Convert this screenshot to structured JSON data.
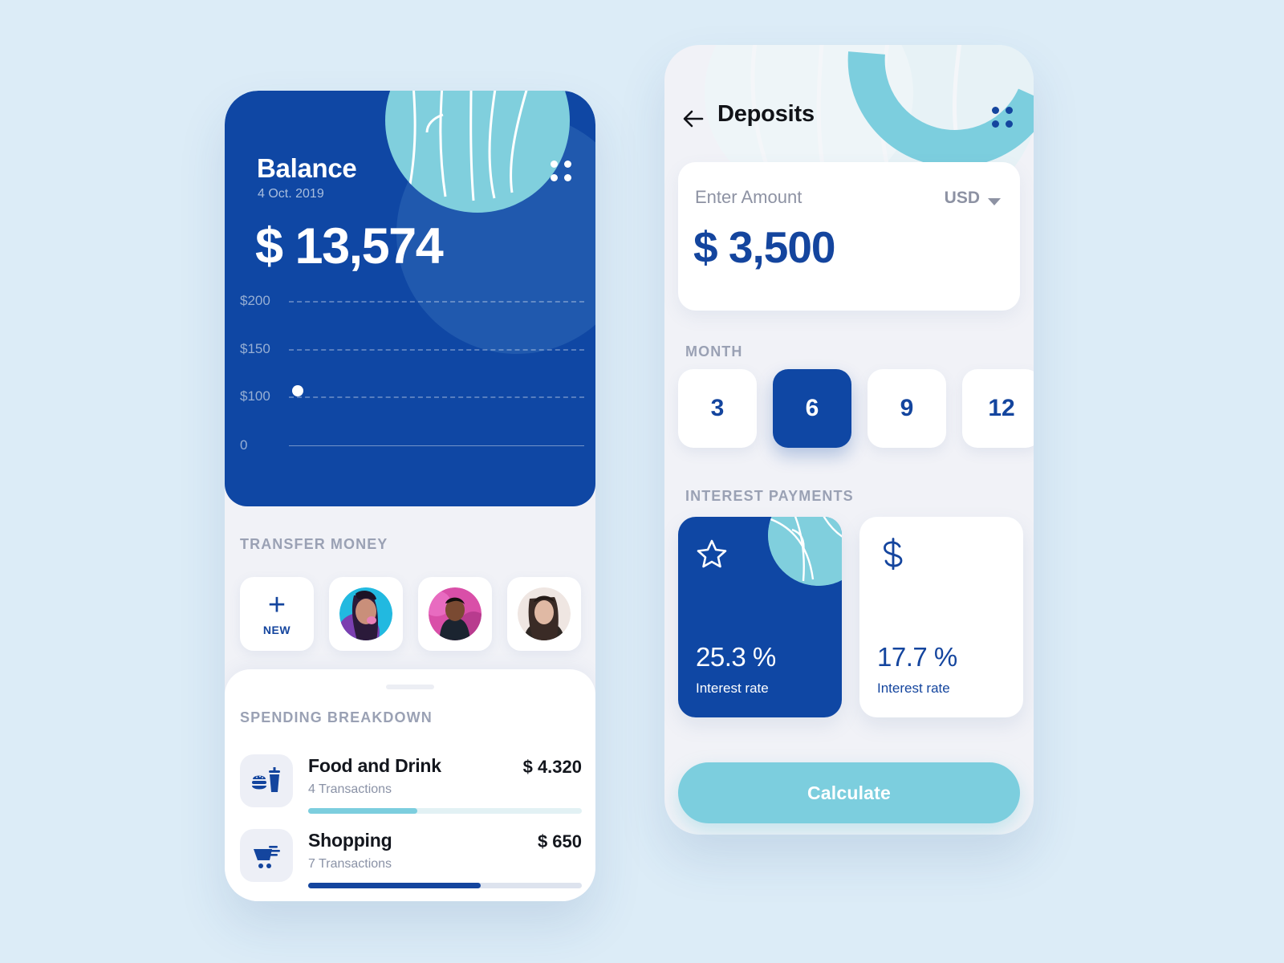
{
  "theme": {
    "page_bg": "#dcecf7",
    "brand_blue": "#0f47a4",
    "accent_teal": "#7ccede",
    "card_bg": "#ffffff",
    "panel_bg": "#f1f2f7",
    "muted_text": "#9aa1b4"
  },
  "balance_screen": {
    "title": "Balance",
    "date": "4 Oct. 2019",
    "amount": "$ 13,574",
    "menu_icon": "grid-menu-icon",
    "chart_data": {
      "type": "line",
      "title": "Balance",
      "xlabel": "",
      "ylabel": "",
      "categories": [],
      "tick_labels": [
        "$200",
        "$150",
        "$100",
        "0"
      ],
      "tick_values": [
        200,
        150,
        100,
        0
      ],
      "ylim": [
        0,
        200
      ],
      "grid": true,
      "gridline_style": "dashed",
      "baseline_style": "solid",
      "series": [
        {
          "name": "Balance point",
          "points": [
            {
              "x": 0,
              "y": 100
            }
          ]
        }
      ],
      "marker": {
        "value": 100,
        "label": "$100",
        "color": "#ffffff"
      }
    },
    "transfer": {
      "section_label": "TRANSFER MONEY",
      "new_card": {
        "icon": "plus-icon",
        "label": "NEW"
      },
      "contacts": [
        {
          "name": "contact-1",
          "avatar": "woman-teal-portrait"
        },
        {
          "name": "contact-2",
          "avatar": "man-magenta-portrait"
        },
        {
          "name": "contact-3",
          "avatar": "woman-neutral-portrait"
        }
      ]
    },
    "spending": {
      "section_label": "SPENDING BREAKDOWN",
      "rows": [
        {
          "icon": "burger-drink-icon",
          "name": "Food and Drink",
          "amount": "$ 4.320",
          "transactions": "4 Transactions",
          "progress_percent": 40,
          "fill_color": "#7ccede",
          "track_color": "#e2f1f4"
        },
        {
          "icon": "shopping-cart-icon",
          "name": "Shopping",
          "amount": "$ 650",
          "transactions": "7 Transactions",
          "progress_percent": 63,
          "fill_color": "#14459e",
          "track_color": "#dde3ee"
        }
      ]
    }
  },
  "deposits_screen": {
    "back_icon": "back-arrow-icon",
    "title": "Deposits",
    "menu_icon": "grid-menu-icon",
    "amount_input": {
      "label": "Enter Amount",
      "currency": "USD",
      "currency_caret": "chevron-down-icon",
      "value": "$ 3,500"
    },
    "month": {
      "section_label": "MONTH",
      "options": [
        "3",
        "6",
        "9",
        "12"
      ],
      "selected": "6"
    },
    "interest": {
      "section_label": "INTEREST PAYMENTS",
      "cards": [
        {
          "icon": "star-icon",
          "value": "25.3 %",
          "sub": "Interest rate",
          "selected": true
        },
        {
          "icon": "dollar-icon",
          "value": "17.7 %",
          "sub": "Interest rate",
          "selected": false
        }
      ]
    },
    "calculate_label": "Calculate"
  }
}
